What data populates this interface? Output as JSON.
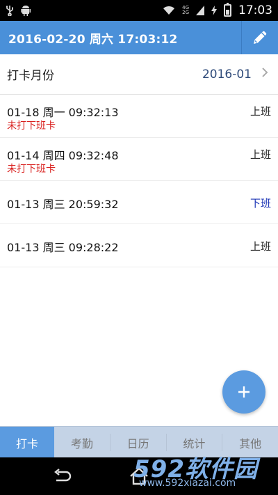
{
  "status_bar": {
    "time": "17:03",
    "net_top": "4G",
    "net_bottom": "2G",
    "icons": [
      "usb-icon",
      "android-icon",
      "wifi-icon",
      "signal-icon",
      "charging-icon",
      "battery-icon"
    ]
  },
  "header": {
    "title": "2016-02-20 周六 17:03:12",
    "edit_icon": "pencil-icon",
    "color": "#4a90d9"
  },
  "month": {
    "label": "打卡月份",
    "value": "2016-01"
  },
  "records": [
    {
      "time": "01-18 周一 09:32:13",
      "type": "上班",
      "note": "未打下班卡"
    },
    {
      "time": "01-14 周四 09:32:48",
      "type": "上班",
      "note": "未打下班卡"
    },
    {
      "time": "01-13 周三 20:59:32",
      "type": "下班",
      "note": ""
    },
    {
      "time": "01-13 周三 09:28:22",
      "type": "上班",
      "note": ""
    }
  ],
  "fab": {
    "icon": "plus-icon"
  },
  "tabs": [
    {
      "label": "打卡",
      "active": true
    },
    {
      "label": "考勤",
      "active": false
    },
    {
      "label": "日历",
      "active": false
    },
    {
      "label": "统计",
      "active": false
    },
    {
      "label": "其他",
      "active": false
    }
  ],
  "nav": {
    "icons": [
      "back-icon",
      "home-icon"
    ]
  },
  "watermark": {
    "logo": "592软件园",
    "url": "www.592xiazai.com"
  }
}
